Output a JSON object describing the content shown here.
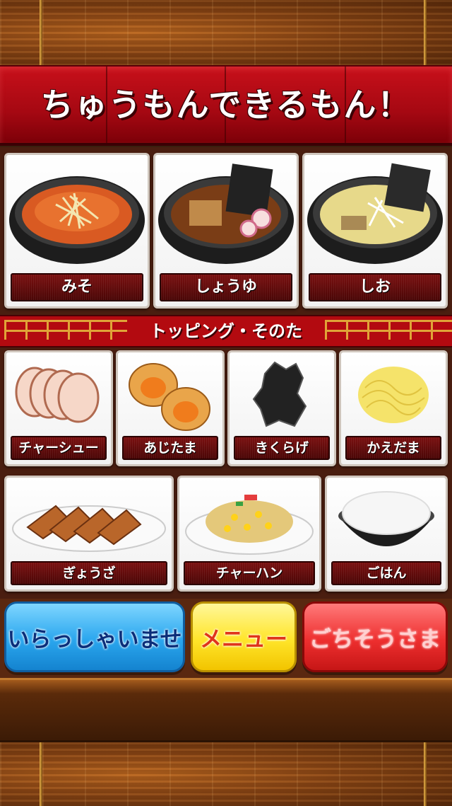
{
  "banner": {
    "title": "ちゅうもんできるもん！"
  },
  "ramen": [
    {
      "label": "みそ",
      "icon": "miso-ramen-icon"
    },
    {
      "label": "しょうゆ",
      "icon": "shoyu-ramen-icon"
    },
    {
      "label": "しお",
      "icon": "shio-ramen-icon"
    }
  ],
  "toppings_header": "トッピング・そのた",
  "toppings": [
    {
      "label": "チャーシュー",
      "icon": "chashu-icon"
    },
    {
      "label": "あじたま",
      "icon": "ajitama-egg-icon"
    },
    {
      "label": "きくらげ",
      "icon": "kikurage-mushroom-icon"
    },
    {
      "label": "かえだま",
      "icon": "kaedama-noodles-icon"
    }
  ],
  "sides": [
    {
      "label": "ぎょうざ",
      "icon": "gyoza-icon"
    },
    {
      "label": "チャーハン",
      "icon": "fried-rice-icon"
    },
    {
      "label": "ごはん",
      "icon": "rice-bowl-icon"
    }
  ],
  "buttons": {
    "welcome": "いらっしゃいませ",
    "menu": "メニュー",
    "thanks": "ごちそうさま"
  },
  "colors": {
    "banner_red": "#b30a10",
    "welcome_blue": "#2aa6ee",
    "menu_yellow": "#ffe52a",
    "thanks_red": "#ee2f2f"
  }
}
